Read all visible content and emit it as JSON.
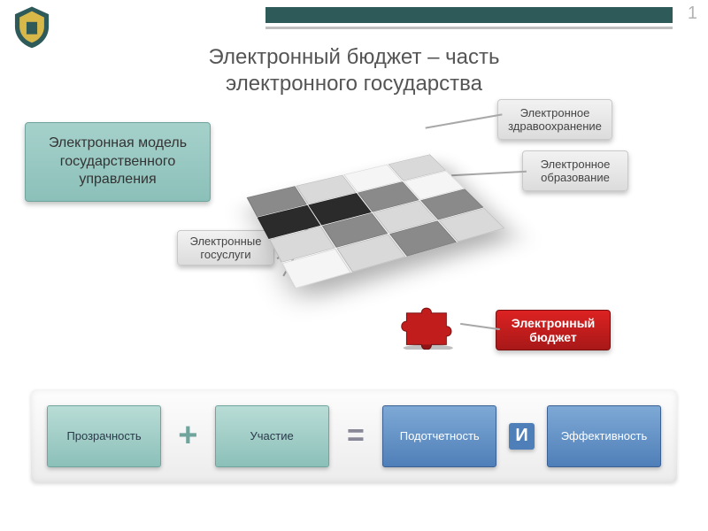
{
  "page_number": "1",
  "title": "Электронный бюджет – часть электронного государства",
  "callouts": {
    "model": "Электронная модель государственного управления",
    "health": "Электронное здравоохранение",
    "education": "Электронное образование",
    "services": "Электронные госуслуги",
    "budget": "Электронный бюджет"
  },
  "equation": {
    "transparency": "Прозрачность",
    "participation": "Участие",
    "accountability": "Подотчетность",
    "efficiency": "Эффективность",
    "op_plus": "+",
    "op_eq": "=",
    "op_and": "И"
  },
  "colors": {
    "teal": "#8bc0b9",
    "red": "#c21d1d",
    "blue": "#4f7fb8",
    "header": "#2f5a5a"
  }
}
